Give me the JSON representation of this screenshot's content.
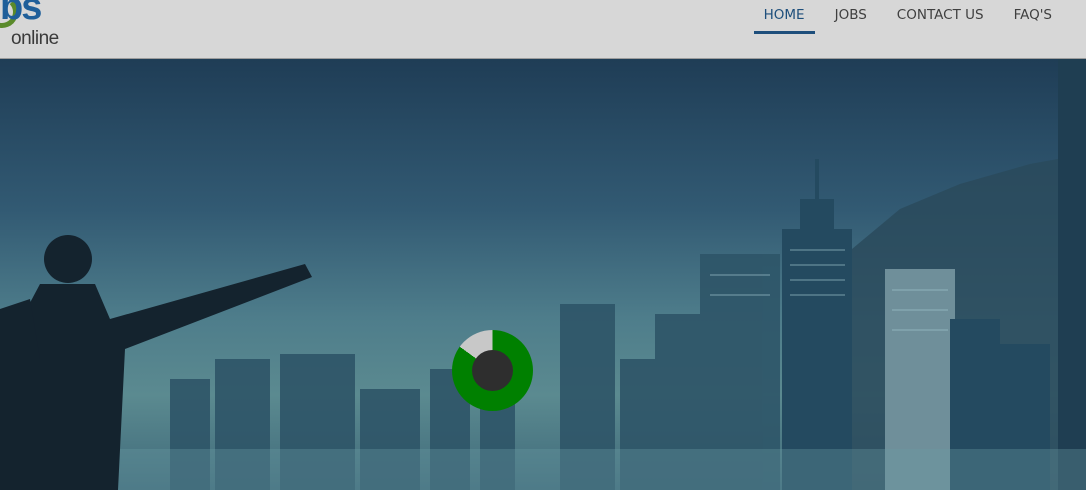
{
  "logo": {
    "text_bs": "bs",
    "text_online": "online"
  },
  "nav": {
    "items": [
      {
        "label": "HOME",
        "active": true
      },
      {
        "label": "JOBS",
        "active": false
      },
      {
        "label": "CONTACT US",
        "active": false
      },
      {
        "label": "FAQ'S",
        "active": false
      }
    ]
  },
  "hero": {
    "image": "city-skyline-man-arms-open"
  },
  "loader": {
    "progress": 0.85,
    "color": "#008000",
    "track_color": "#c8c8c8"
  },
  "colors": {
    "accent": "#1d4e7b",
    "header_bg": "#d7d7d7"
  }
}
